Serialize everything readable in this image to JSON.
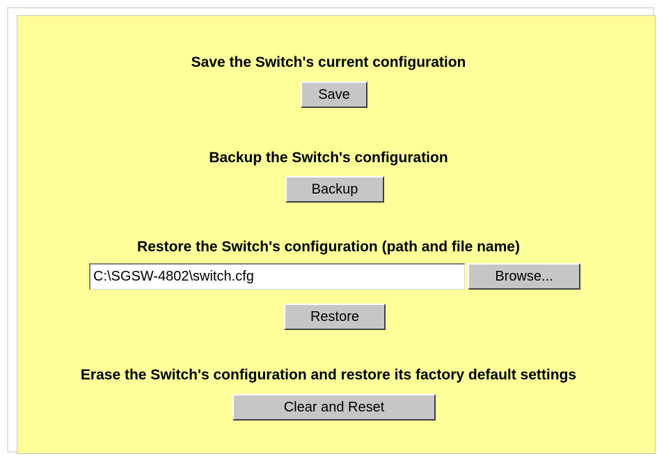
{
  "save": {
    "heading": "Save the Switch's current configuration",
    "button_label": "Save"
  },
  "backup": {
    "heading": "Backup the Switch's configuration",
    "button_label": "Backup"
  },
  "restore": {
    "heading": "Restore the Switch's configuration (path and file name)",
    "file_path_value": "C:\\SGSW-4802\\switch.cfg",
    "browse_label": "Browse...",
    "button_label": "Restore"
  },
  "erase": {
    "heading": "Erase the Switch's configuration and restore its factory default settings",
    "button_label": "Clear and Reset"
  },
  "colors": {
    "panel_background": "#ffff99",
    "button_face": "#c6c6c6"
  }
}
